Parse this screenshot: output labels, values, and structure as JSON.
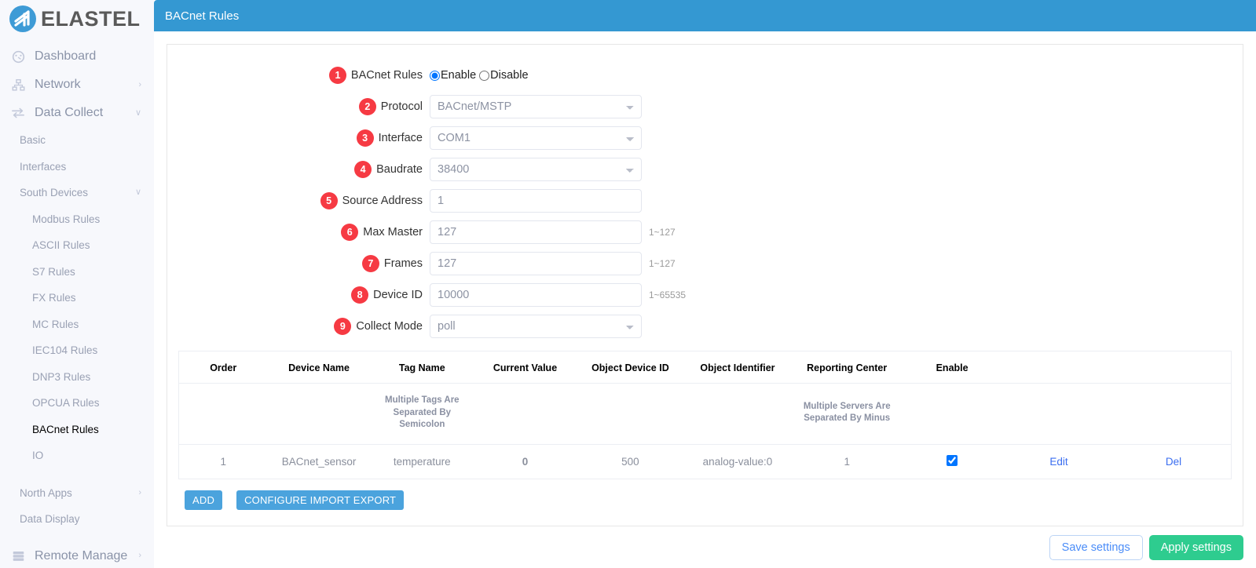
{
  "brand": {
    "name": "ELASTEL",
    "logo_color": "#3e9bd6"
  },
  "header": {
    "title": "BACnet Rules",
    "bg": "#3498d2"
  },
  "sidebar": {
    "top_items": [
      {
        "label": "Dashboard",
        "icon": "dashboard-icon",
        "chevron": ""
      },
      {
        "label": "Network",
        "icon": "network-icon",
        "chevron": "›"
      },
      {
        "label": "Data Collect",
        "icon": "data-collect-icon",
        "chevron": "∨"
      }
    ],
    "sub_items": [
      {
        "label": "Basic",
        "level": 1,
        "chevron": "",
        "active": false
      },
      {
        "label": "Interfaces",
        "level": 1,
        "chevron": "",
        "active": false
      },
      {
        "label": "South Devices",
        "level": 1,
        "chevron": "∨",
        "active": false
      },
      {
        "label": "Modbus Rules",
        "level": 2,
        "chevron": "",
        "active": false
      },
      {
        "label": "ASCII Rules",
        "level": 2,
        "chevron": "",
        "active": false
      },
      {
        "label": "S7 Rules",
        "level": 2,
        "chevron": "",
        "active": false
      },
      {
        "label": "FX Rules",
        "level": 2,
        "chevron": "",
        "active": false
      },
      {
        "label": "MC Rules",
        "level": 2,
        "chevron": "",
        "active": false
      },
      {
        "label": "IEC104 Rules",
        "level": 2,
        "chevron": "",
        "active": false
      },
      {
        "label": "DNP3 Rules",
        "level": 2,
        "chevron": "",
        "active": false
      },
      {
        "label": "OPCUA Rules",
        "level": 2,
        "chevron": "",
        "active": false
      },
      {
        "label": "BACnet Rules",
        "level": 2,
        "chevron": "",
        "active": true
      },
      {
        "label": "IO",
        "level": 2,
        "chevron": "",
        "active": false
      }
    ],
    "lower_items": [
      {
        "label": "North Apps",
        "level": 1,
        "chevron": "›",
        "active": false
      },
      {
        "label": "Data Display",
        "level": 1,
        "chevron": "",
        "active": false
      }
    ],
    "bottom_items": [
      {
        "label": "Remote Manage",
        "icon": "server-icon",
        "chevron": "›"
      }
    ]
  },
  "form": {
    "badge_color": "#f63a43",
    "rows": [
      {
        "badge": "1",
        "label": "BACnet Rules",
        "type": "radio",
        "options": [
          "Enable",
          "Disable"
        ],
        "selected": "Enable",
        "hint": ""
      },
      {
        "badge": "2",
        "label": "Protocol",
        "type": "select",
        "value": "BACnet/MSTP",
        "hint": ""
      },
      {
        "badge": "3",
        "label": "Interface",
        "type": "select",
        "value": "COM1",
        "hint": ""
      },
      {
        "badge": "4",
        "label": "Baudrate",
        "type": "select",
        "value": "38400",
        "hint": ""
      },
      {
        "badge": "5",
        "label": "Source Address",
        "type": "text",
        "value": "1",
        "hint": ""
      },
      {
        "badge": "6",
        "label": "Max Master",
        "type": "text",
        "value": "127",
        "hint": "1~127"
      },
      {
        "badge": "7",
        "label": "Frames",
        "type": "text",
        "value": "127",
        "hint": "1~127"
      },
      {
        "badge": "8",
        "label": "Device ID",
        "type": "text",
        "value": "10000",
        "hint": "1~65535"
      },
      {
        "badge": "9",
        "label": "Collect Mode",
        "type": "select",
        "value": "poll",
        "hint": ""
      }
    ]
  },
  "table": {
    "headers": [
      "Order",
      "Device Name",
      "Tag Name",
      "Current Value",
      "Object Device ID",
      "Object Identifier",
      "Reporting Center",
      "Enable",
      "",
      ""
    ],
    "subheaders": [
      "",
      "",
      "Multiple Tags Are Separated By Semicolon",
      "",
      "",
      "",
      "Multiple Servers Are Separated By Minus",
      "",
      "",
      ""
    ],
    "rows": [
      {
        "order": "1",
        "device_name": "BACnet_sensor",
        "tag_name": "temperature",
        "current_value": "0",
        "object_device_id": "500",
        "object_identifier": "analog-value:0",
        "reporting_center": "1",
        "enable": true,
        "edit_label": "Edit",
        "del_label": "Del"
      }
    ]
  },
  "buttons": {
    "add": "ADD",
    "configure": "CONFIGURE IMPORT EXPORT",
    "save": "Save settings",
    "apply": "Apply settings"
  }
}
